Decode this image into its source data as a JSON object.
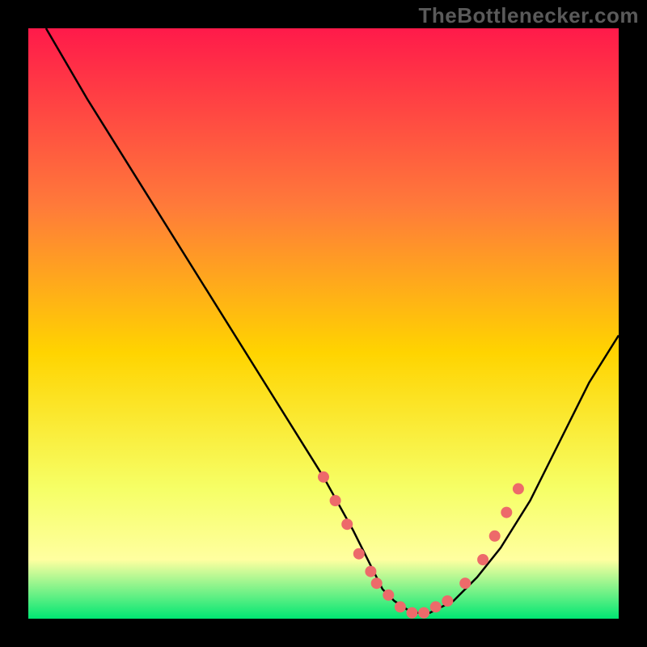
{
  "watermark": "TheBottlenecker.com",
  "colors": {
    "gradient_top": "#ff1a4a",
    "gradient_mid_upper": "#ff7a3a",
    "gradient_mid": "#ffd400",
    "gradient_mid_lower": "#f6ff66",
    "gradient_band": "#ffffa0",
    "gradient_bottom": "#00e673",
    "curve": "#000000",
    "marker": "#ed6a6a"
  },
  "chart_data": {
    "type": "line",
    "title": "",
    "xlabel": "",
    "ylabel": "",
    "xlim": [
      0,
      100
    ],
    "ylim": [
      0,
      100
    ],
    "grid": false,
    "legend": false,
    "series": [
      {
        "name": "bottleneck_curve",
        "x": [
          3,
          10,
          20,
          30,
          40,
          50,
          55,
          58,
          60,
          62,
          65,
          68,
          72,
          76,
          80,
          85,
          90,
          95,
          100
        ],
        "y": [
          100,
          88,
          72,
          56,
          40,
          24,
          15,
          9,
          5,
          3,
          1,
          1,
          3,
          7,
          12,
          20,
          30,
          40,
          48
        ]
      }
    ],
    "markers": [
      {
        "x": 50,
        "y": 24
      },
      {
        "x": 52,
        "y": 20
      },
      {
        "x": 54,
        "y": 16
      },
      {
        "x": 56,
        "y": 11
      },
      {
        "x": 58,
        "y": 8
      },
      {
        "x": 59,
        "y": 6
      },
      {
        "x": 61,
        "y": 4
      },
      {
        "x": 63,
        "y": 2
      },
      {
        "x": 65,
        "y": 1
      },
      {
        "x": 67,
        "y": 1
      },
      {
        "x": 69,
        "y": 2
      },
      {
        "x": 71,
        "y": 3
      },
      {
        "x": 74,
        "y": 6
      },
      {
        "x": 77,
        "y": 10
      },
      {
        "x": 79,
        "y": 14
      },
      {
        "x": 81,
        "y": 18
      },
      {
        "x": 83,
        "y": 22
      }
    ]
  }
}
